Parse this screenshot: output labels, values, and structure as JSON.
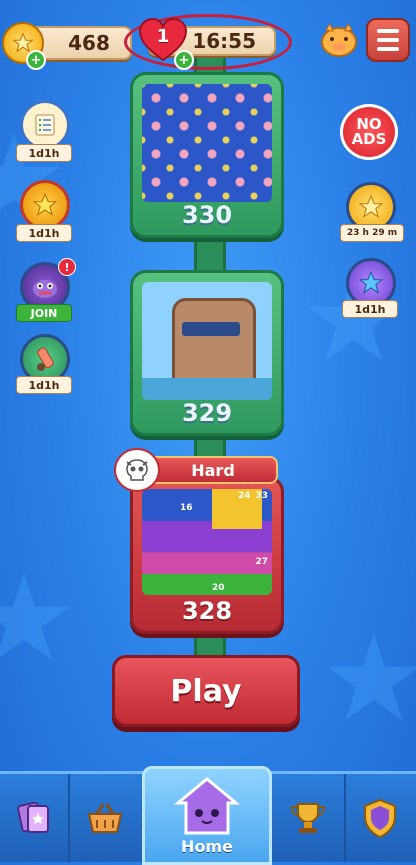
{
  "hud": {
    "coins": "468",
    "lives": "1",
    "timer": "16:55"
  },
  "side_left": [
    {
      "icon": "quest-scroll-icon",
      "label": "1d1h"
    },
    {
      "icon": "star-medal-icon",
      "label": "1d1h"
    },
    {
      "icon": "monster-event-icon",
      "label": "JOIN"
    },
    {
      "icon": "cannon-icon",
      "label": "1d1h"
    }
  ],
  "side_right": [
    {
      "icon": "no-ads-icon",
      "label": "NO\nADS"
    },
    {
      "icon": "coin-bomb-icon",
      "label": "23 h 29 m"
    },
    {
      "icon": "star-key-icon",
      "label": "1d1h"
    }
  ],
  "levels": [
    {
      "number": "330",
      "state": "completed"
    },
    {
      "number": "329",
      "state": "completed"
    },
    {
      "number": "328",
      "state": "current",
      "difficulty": "Hard",
      "hint_numbers": [
        "24",
        "16",
        "33",
        "27",
        "20"
      ]
    }
  ],
  "play_label": "Play",
  "nav": {
    "items": [
      {
        "icon": "cards-icon"
      },
      {
        "icon": "shop-basket-icon"
      },
      {
        "icon": "home-icon",
        "label": "Home"
      },
      {
        "icon": "trophy-icon"
      },
      {
        "icon": "shield-icon"
      }
    ]
  },
  "colors": {
    "background": "#2a7fe6",
    "level_card_done": "#3aa86a",
    "level_card_current": "#c8323c",
    "play_button": "#c8323c"
  }
}
